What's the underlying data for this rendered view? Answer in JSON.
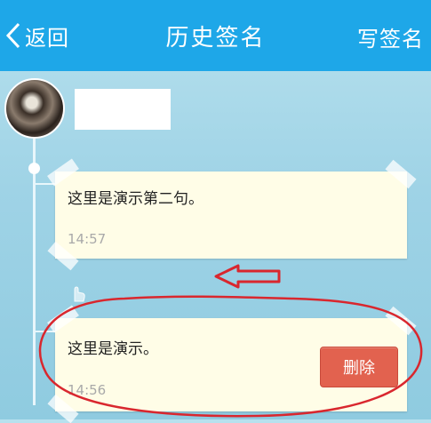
{
  "header": {
    "back_label": "返回",
    "title": "历史签名",
    "write_label": "写签名",
    "background": "#1ea7e8"
  },
  "signatures": [
    {
      "text": "这里是演示第二句。",
      "time": "14:57"
    },
    {
      "text": "这里是演示。",
      "time": "14:56",
      "delete_label": "删除"
    }
  ],
  "annotations": {
    "arrow_color": "#d9272e",
    "circle_color": "#d9272e"
  }
}
